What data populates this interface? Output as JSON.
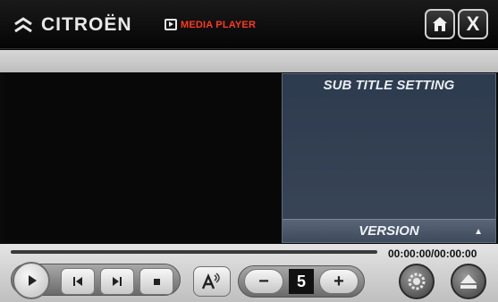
{
  "header": {
    "brand": "CITROËN",
    "section_label": "MEDIA PLAYER",
    "icons": {
      "logo": "citroen-chevrons-icon",
      "section": "media-player-icon",
      "home": "home-icon",
      "close": "close-icon"
    },
    "close_glyph": "X"
  },
  "subtitle_panel": {
    "title": "SUB TITLE SETTING",
    "footer_label": "VERSION",
    "footer_arrow": "▲"
  },
  "controls": {
    "time_display": "00:00:00/00:00:00",
    "progress": 0,
    "subtitle_size": "5",
    "minus_label": "−",
    "plus_label": "+",
    "icons": {
      "play": "play-icon",
      "previous": "previous-track-icon",
      "next": "next-track-icon",
      "stop": "stop-icon",
      "subtitle": "subtitle-icon",
      "settings": "settings-icon",
      "eject": "eject-icon"
    }
  },
  "colors": {
    "section_label": "#ff3a1e",
    "panel_bg": "#2d3b4e",
    "background": "#0a0a0a"
  }
}
